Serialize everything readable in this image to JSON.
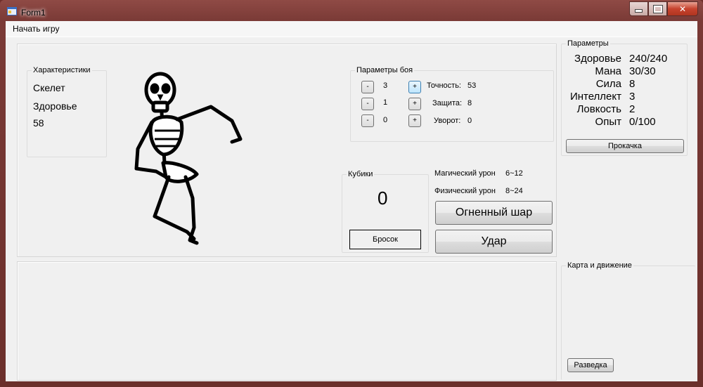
{
  "window": {
    "title": "Form1"
  },
  "menu": {
    "start_game": "Начать игру"
  },
  "characteristics": {
    "title": "Характеристики",
    "name": "Скелет",
    "health_label": "Здоровье",
    "health_value": "58"
  },
  "battle_params": {
    "title": "Параметры боя",
    "rows": [
      {
        "minus": "-",
        "value": "3",
        "plus": "+",
        "label": "Точность:",
        "stat": "53"
      },
      {
        "minus": "-",
        "value": "1",
        "plus": "+",
        "label": "Защита:",
        "stat": "8"
      },
      {
        "minus": "-",
        "value": "0",
        "plus": "+",
        "label": "Уворот:",
        "stat": "0"
      }
    ]
  },
  "dice": {
    "title": "Кубики",
    "value": "0",
    "roll_button": "Бросок"
  },
  "damage": {
    "magic_label": "Магический урон",
    "magic_value": "6~12",
    "physical_label": "Физический урон",
    "physical_value": "8~24"
  },
  "actions": {
    "fireball": "Огненный шар",
    "strike": "Удар"
  },
  "parameters": {
    "title": "Параметры",
    "rows": [
      {
        "label": "Здоровье",
        "value": "240/240"
      },
      {
        "label": "Мана",
        "value": "30/30"
      },
      {
        "label": "Сила",
        "value": "8"
      },
      {
        "label": "Интеллект",
        "value": "3"
      },
      {
        "label": "Ловкость",
        "value": "2"
      },
      {
        "label": "Опыт",
        "value": "0/100"
      }
    ],
    "level_up_button": "Прокачка"
  },
  "map": {
    "title": "Карта и движение",
    "scout_button": "Разведка"
  }
}
